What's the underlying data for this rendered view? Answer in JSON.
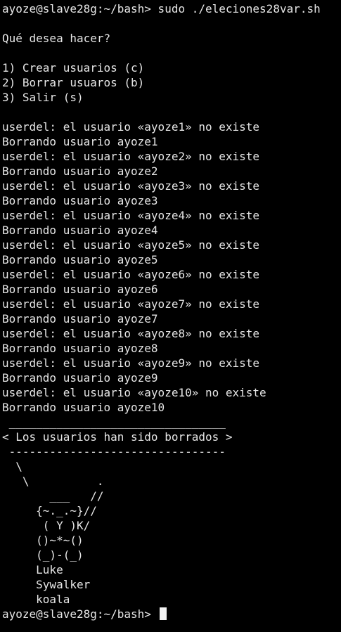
{
  "terminal": {
    "lines": [
      "ayoze@slave28g:~/bash> sudo ./eleciones28var.sh",
      "",
      "Qué desea hacer?",
      "",
      "1) Crear usuarios (c)",
      "2) Borrar usuaros (b)",
      "3) Salir (s)",
      "",
      "userdel: el usuario «ayoze1» no existe",
      "Borrando usuario ayoze1",
      "userdel: el usuario «ayoze2» no existe",
      "Borrando usuario ayoze2",
      "userdel: el usuario «ayoze3» no existe",
      "Borrando usuario ayoze3",
      "userdel: el usuario «ayoze4» no existe",
      "Borrando usuario ayoze4",
      "userdel: el usuario «ayoze5» no existe",
      "Borrando usuario ayoze5",
      "userdel: el usuario «ayoze6» no existe",
      "Borrando usuario ayoze6",
      "userdel: el usuario «ayoze7» no existe",
      "Borrando usuario ayoze7",
      "userdel: el usuario «ayoze8» no existe",
      "Borrando usuario ayoze8",
      "userdel: el usuario «ayoze9» no existe",
      "Borrando usuario ayoze9",
      "userdel: el usuario «ayoze10» no existe",
      "Borrando usuario ayoze10",
      " ________________________________",
      "< Los usuarios han sido borrados >",
      " --------------------------------",
      "  \\",
      "   \\          .",
      "       ___   //",
      "     {~._.~}//",
      "      ( Y )K/",
      "     ()~*~()",
      "     (_)-(_)",
      "     Luke",
      "     Sywalker",
      "     koala"
    ],
    "prompt": "ayoze@slave28g:~/bash> ",
    "colors": {
      "background": "#000000",
      "foreground": "#e6e6e6",
      "cursor": "#f2f2f2"
    }
  }
}
